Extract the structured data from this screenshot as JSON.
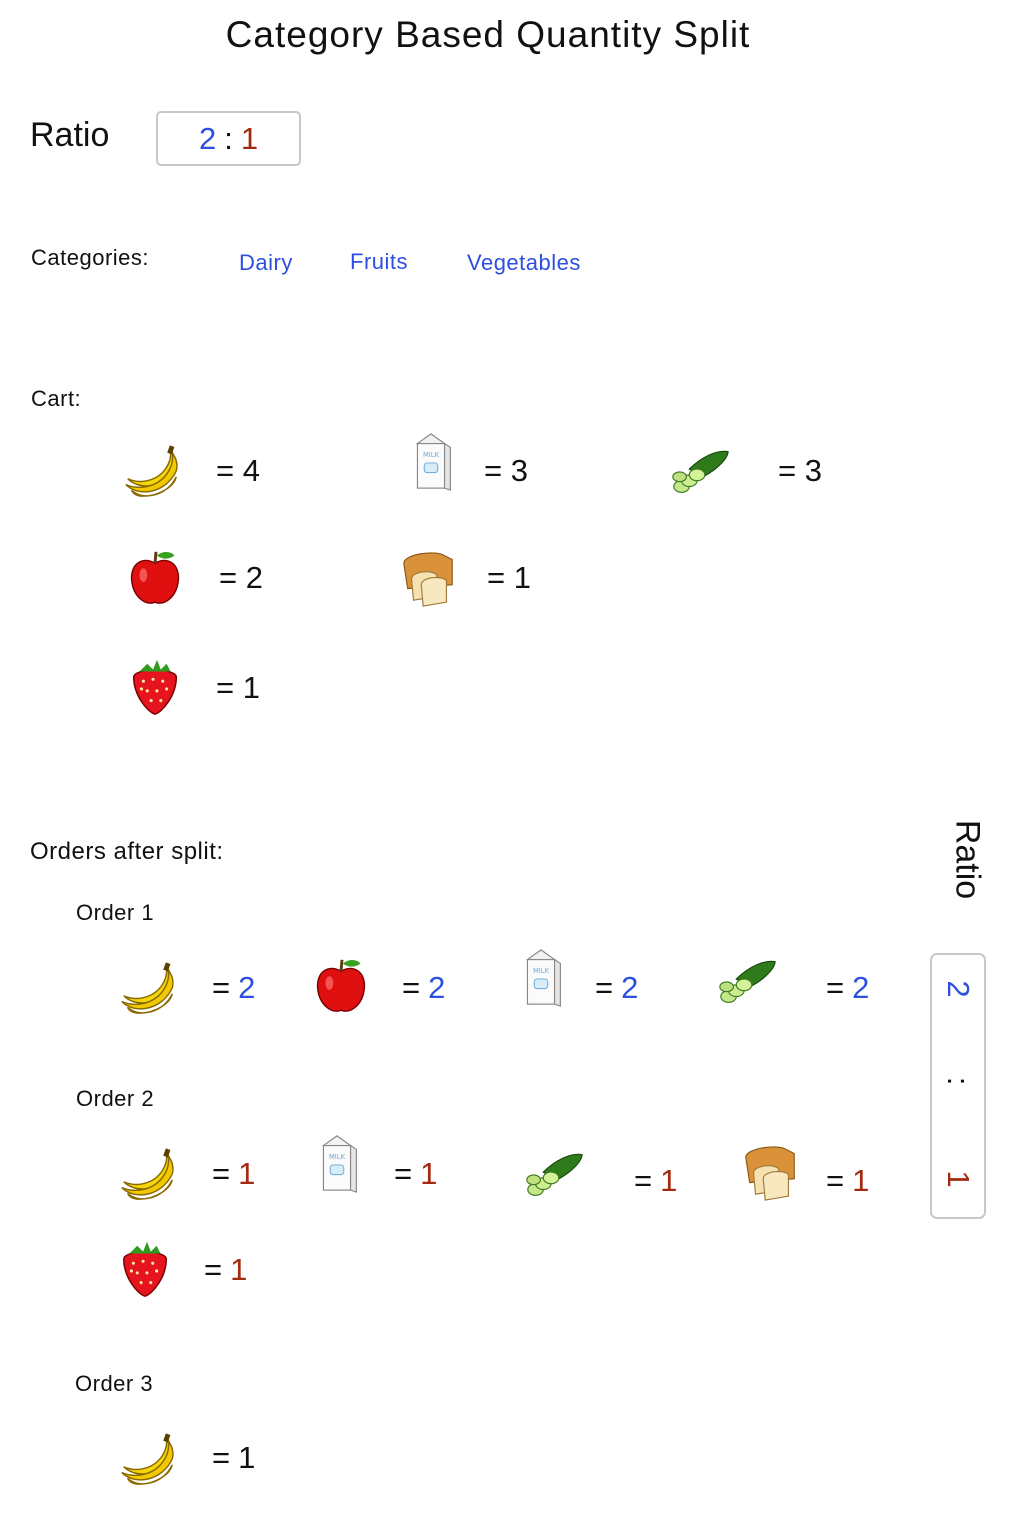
{
  "title": "Category Based Quantity Split",
  "ratio": {
    "label": "Ratio",
    "left": "2",
    "sep": ":",
    "right": "1"
  },
  "categories": {
    "label": "Categories:",
    "items": [
      "Dairy",
      "Fruits",
      "Vegetables"
    ]
  },
  "cart": {
    "label": "Cart:",
    "items": [
      {
        "icon": "banana-icon",
        "text": "= 4"
      },
      {
        "icon": "milk-carton-icon",
        "text": "= 3"
      },
      {
        "icon": "cucumber-icon",
        "text": "= 3"
      },
      {
        "icon": "apple-icon",
        "text": "= 2"
      },
      {
        "icon": "bread-icon",
        "text": "= 1"
      },
      {
        "icon": "strawberry-icon",
        "text": "= 1"
      }
    ]
  },
  "orders": {
    "label": "Orders after split:",
    "list": [
      {
        "name": "Order 1",
        "items": [
          {
            "icon": "banana-icon",
            "eq": "=",
            "qty": "2"
          },
          {
            "icon": "apple-icon",
            "eq": "=",
            "qty": "2"
          },
          {
            "icon": "milk-carton-icon",
            "eq": "=",
            "qty": "2"
          },
          {
            "icon": "cucumber-icon",
            "eq": "=",
            "qty": "2"
          }
        ]
      },
      {
        "name": "Order 2",
        "items": [
          {
            "icon": "banana-icon",
            "eq": "=",
            "qty": "1"
          },
          {
            "icon": "milk-carton-icon",
            "eq": "=",
            "qty": "1"
          },
          {
            "icon": "cucumber-icon",
            "eq": "=",
            "qty": "1"
          },
          {
            "icon": "bread-icon",
            "eq": "=",
            "qty": "1"
          },
          {
            "icon": "strawberry-icon",
            "eq": "=",
            "qty": "1"
          }
        ]
      },
      {
        "name": "Order 3",
        "items": [
          {
            "icon": "banana-icon",
            "eq": "=",
            "qty": "1"
          }
        ]
      }
    ]
  },
  "side_ratio": {
    "label": "Ratio",
    "top": "2",
    "sep": ":",
    "bottom": "1"
  },
  "colors": {
    "blue": "#2d4fe0",
    "red": "#a32a10",
    "border": "#c8c8c8"
  }
}
